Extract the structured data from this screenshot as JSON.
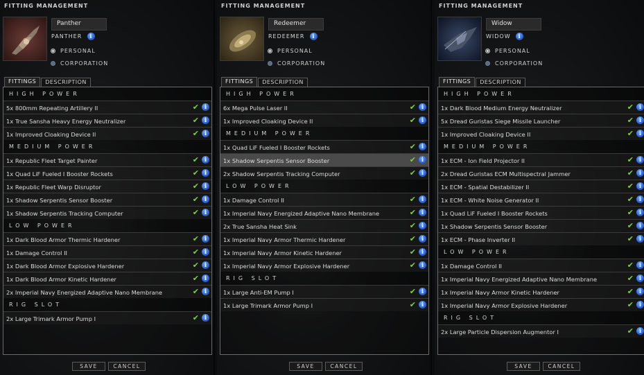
{
  "panels": [
    {
      "title": "FITTING MANAGEMENT",
      "name": "Panther",
      "ship_type": "PANTHER",
      "radio_personal": "PERSONAL",
      "radio_corporation": "CORPORATION",
      "tab_fittings": "FITTINGS",
      "tab_description": "DESCRIPTION",
      "save": "SAVE",
      "cancel": "CANCEL",
      "rows": [
        {
          "kind": "section",
          "text": "HIGH POWER"
        },
        {
          "kind": "module",
          "text": "5x 800mm Repeating Artillery II"
        },
        {
          "kind": "module",
          "text": "1x True Sansha Heavy Energy Neutralizer"
        },
        {
          "kind": "module",
          "text": "1x Improved Cloaking Device II"
        },
        {
          "kind": "section",
          "text": "MEDIUM POWER"
        },
        {
          "kind": "module",
          "text": "1x Republic Fleet Target Painter"
        },
        {
          "kind": "module",
          "text": "1x Quad LiF Fueled I Booster Rockets"
        },
        {
          "kind": "module",
          "text": "1x Republic Fleet Warp Disruptor"
        },
        {
          "kind": "module",
          "text": "1x Shadow Serpentis Sensor Booster"
        },
        {
          "kind": "module",
          "text": "1x Shadow Serpentis Tracking Computer"
        },
        {
          "kind": "section",
          "text": "LOW POWER"
        },
        {
          "kind": "module",
          "text": "1x Dark Blood Armor Thermic Hardener"
        },
        {
          "kind": "module",
          "text": "1x Damage Control II"
        },
        {
          "kind": "module",
          "text": "1x Dark Blood Armor Explosive Hardener"
        },
        {
          "kind": "module",
          "text": "1x Dark Blood Armor Kinetic Hardener"
        },
        {
          "kind": "module",
          "text": "2x Imperial Navy Energized Adaptive Nano Membrane"
        },
        {
          "kind": "section",
          "text": "RIG SLOT"
        },
        {
          "kind": "module",
          "text": "2x Large Trimark Armor Pump I"
        }
      ]
    },
    {
      "title": "FITTING MANAGEMENT",
      "name": "Redeemer",
      "ship_type": "REDEEMER",
      "radio_personal": "PERSONAL",
      "radio_corporation": "CORPORATION",
      "tab_fittings": "FITTINGS",
      "tab_description": "DESCRIPTION",
      "save": "SAVE",
      "cancel": "CANCEL",
      "rows": [
        {
          "kind": "section",
          "text": "HIGH POWER"
        },
        {
          "kind": "module",
          "text": "6x Mega Pulse Laser II"
        },
        {
          "kind": "module",
          "text": "1x Improved Cloaking Device II"
        },
        {
          "kind": "section",
          "text": "MEDIUM POWER"
        },
        {
          "kind": "module",
          "text": "1x Quad LiF Fueled I Booster Rockets"
        },
        {
          "kind": "module",
          "text": "1x Shadow Serpentis Sensor Booster",
          "selected": true
        },
        {
          "kind": "module",
          "text": "2x Shadow Serpentis Tracking Computer"
        },
        {
          "kind": "section",
          "text": "LOW POWER"
        },
        {
          "kind": "module",
          "text": "1x Damage Control II"
        },
        {
          "kind": "module",
          "text": "1x Imperial Navy Energized Adaptive Nano Membrane"
        },
        {
          "kind": "module",
          "text": "2x True Sansha Heat Sink"
        },
        {
          "kind": "module",
          "text": "1x Imperial Navy Armor Thermic Hardener"
        },
        {
          "kind": "module",
          "text": "1x Imperial Navy Armor Kinetic Hardener"
        },
        {
          "kind": "module",
          "text": "1x Imperial Navy Armor Explosive Hardener"
        },
        {
          "kind": "section",
          "text": "RIG SLOT"
        },
        {
          "kind": "module",
          "text": "1x Large Anti-EM Pump I"
        },
        {
          "kind": "module",
          "text": "1x Large Trimark Armor Pump I"
        }
      ]
    },
    {
      "title": "FITTING MANAGEMENT",
      "name": "Widow",
      "ship_type": "WIDOW",
      "radio_personal": "PERSONAL",
      "radio_corporation": "CORPORATION",
      "tab_fittings": "FITTINGS",
      "tab_description": "DESCRIPTION",
      "save": "SAVE",
      "cancel": "CANCEL",
      "rows": [
        {
          "kind": "section",
          "text": "HIGH POWER"
        },
        {
          "kind": "module",
          "text": "1x Dark Blood Medium Energy Neutralizer"
        },
        {
          "kind": "module",
          "text": "5x Dread Guristas Siege Missile Launcher"
        },
        {
          "kind": "module",
          "text": "1x Improved Cloaking Device II"
        },
        {
          "kind": "section",
          "text": "MEDIUM POWER"
        },
        {
          "kind": "module",
          "text": "1x ECM - Ion Field Projector II"
        },
        {
          "kind": "module",
          "text": "2x Dread Guristas ECM Multispectral Jammer"
        },
        {
          "kind": "module",
          "text": "1x ECM - Spatial Destabilizer II"
        },
        {
          "kind": "module",
          "text": "1x ECM - White Noise Generator II"
        },
        {
          "kind": "module",
          "text": "1x Quad LiF Fueled I Booster Rockets"
        },
        {
          "kind": "module",
          "text": "1x Shadow Serpentis Sensor Booster"
        },
        {
          "kind": "module",
          "text": "1x ECM - Phase Inverter II"
        },
        {
          "kind": "section",
          "text": "LOW POWER"
        },
        {
          "kind": "module",
          "text": "1x Damage Control II"
        },
        {
          "kind": "module",
          "text": "1x Imperial Navy Energized Adaptive Nano Membrane"
        },
        {
          "kind": "module",
          "text": "1x Imperial Navy Armor Kinetic Hardener"
        },
        {
          "kind": "module",
          "text": "1x Imperial Navy Armor Explosive Hardener"
        },
        {
          "kind": "section",
          "text": "RIG SLOT"
        },
        {
          "kind": "module",
          "text": "2x Large Particle Dispersion Augmentor I"
        }
      ]
    }
  ],
  "icons": {
    "check": "checkmark-icon",
    "info": "info-icon"
  },
  "colors": {
    "check_green": "#7fd23a",
    "info_blue": "#2a62d8"
  }
}
